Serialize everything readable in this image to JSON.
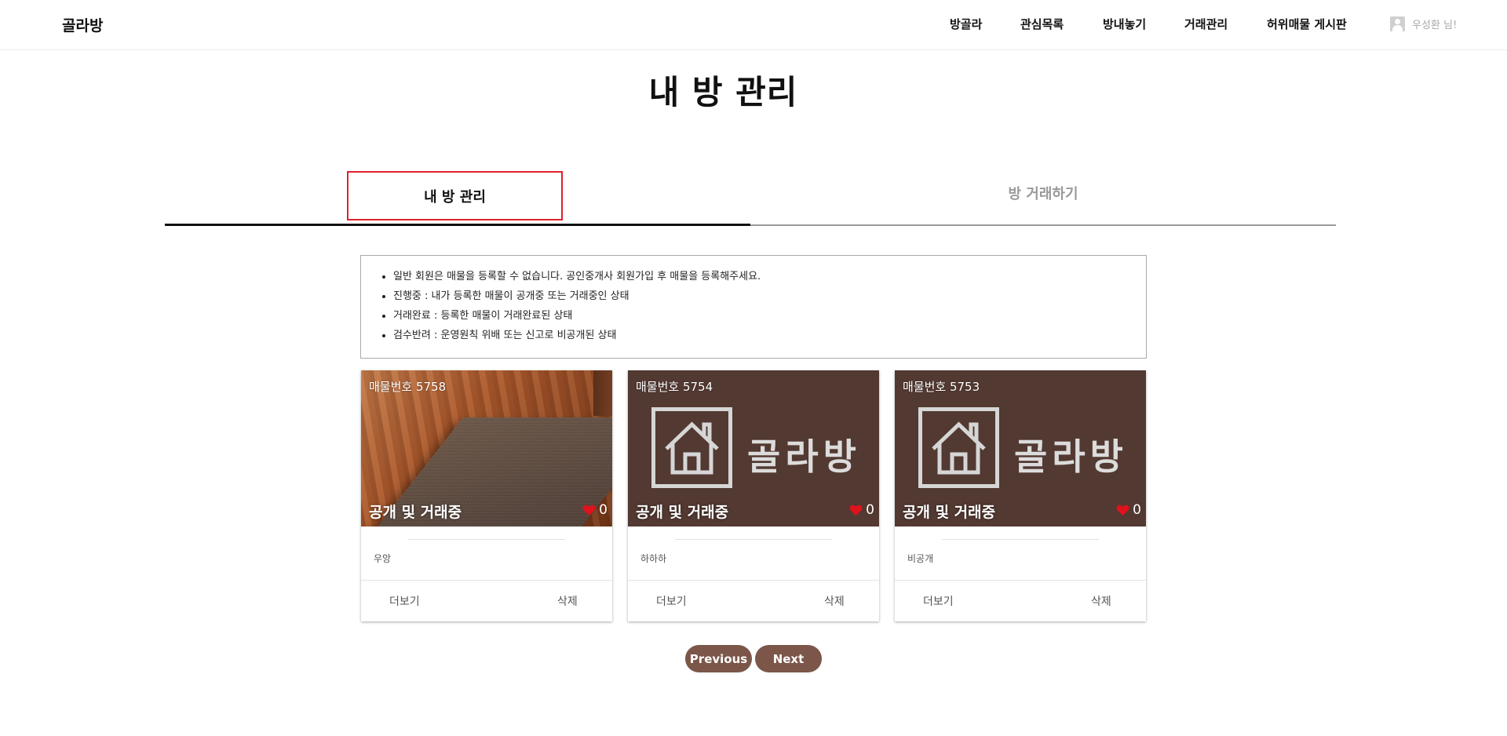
{
  "header": {
    "logo": "골라방",
    "nav": [
      "방골라",
      "관심목록",
      "방내놓기",
      "거래관리",
      "허위매물 게시판"
    ],
    "user_name": "우성환 님!"
  },
  "page_title": "내 방 관리",
  "tabs": [
    {
      "label": "내 방 관리",
      "active": true
    },
    {
      "label": "방 거래하기",
      "active": false
    }
  ],
  "notice": [
    "일반 회원은 매물을 등록할 수 없습니다. 공인중개사 회원가입 후 매물을 등록해주세요.",
    "진행중 : 내가 등록한 매물이 공개중 또는 거래중인 상태",
    "거래완료 : 등록한 매물이 거래완료된 상태",
    "검수반려 : 운영원칙 위배 또는 신고로 비공개된 상태"
  ],
  "cards": [
    {
      "number": "매물번호 5758",
      "status": "공개 및 거래중",
      "likes": "0",
      "desc": "우앙",
      "more": "더보기",
      "delete": "삭제",
      "image": "floor-photo"
    },
    {
      "number": "매물번호 5754",
      "status": "공개 및 거래중",
      "likes": "0",
      "desc": "하하하",
      "more": "더보기",
      "delete": "삭제",
      "image": "placeholder",
      "placeholder_brand": "골라방"
    },
    {
      "number": "매물번호 5753",
      "status": "공개 및 거래중",
      "likes": "0",
      "desc": "비공개",
      "more": "더보기",
      "delete": "삭제",
      "image": "placeholder",
      "placeholder_brand": "골라방"
    }
  ],
  "pagination": {
    "previous": "Previous",
    "next": "Next"
  },
  "colors": {
    "accent_brown": "#7b5649",
    "placeholder_bg": "#523931",
    "active_tab_outline": "#e0222d",
    "heart": "#e0121c"
  },
  "icons": [
    "user-icon",
    "house-icon",
    "heart-icon"
  ]
}
